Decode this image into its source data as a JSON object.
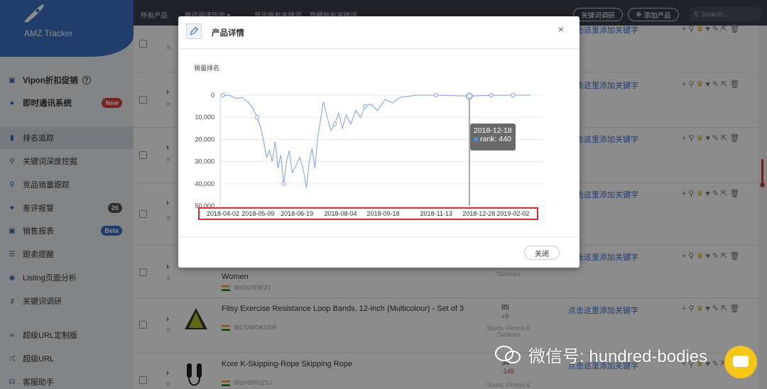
{
  "sidebar": {
    "brand": "AMZ Tracker",
    "items": [
      {
        "label": "Vipon折扣促销",
        "icon": "gift-icon",
        "help": "?"
      },
      {
        "label": "即时通讯系统",
        "icon": "chat-icon",
        "badge": "New"
      },
      {
        "label": "排名追踪",
        "icon": "bar-chart-icon"
      },
      {
        "label": "关键词深度挖掘",
        "icon": "search-icon"
      },
      {
        "label": "竞品销量跟踪",
        "icon": "search-icon"
      },
      {
        "label": "差评报警",
        "icon": "heart-icon",
        "badge": "26"
      },
      {
        "label": "销售报表",
        "icon": "gift-icon",
        "badge": "Beta"
      },
      {
        "label": "跟卖提醒",
        "icon": "list-icon"
      },
      {
        "label": "Listing页面分析",
        "icon": "eye-icon"
      },
      {
        "label": "关键词调研",
        "icon": "key-icon"
      },
      {
        "label": "超级URL定制版",
        "icon": "link-icon"
      },
      {
        "label": "超级URL",
        "icon": "shuffle-icon"
      },
      {
        "label": "客服助手",
        "icon": "headset-icon"
      }
    ]
  },
  "topbar": {
    "all_products": "所有产品",
    "history": "最近阅读历史 ▾",
    "show_all": "显示所有关键词",
    "hide_all": "隐藏所有关键词",
    "keyword_research_btn": "关键词调研",
    "add_product_btn": "添加产品",
    "search_placeholder": "Search..."
  },
  "table": {
    "add_keyword_link": "点击这里添加关键字",
    "rows": [
      {
        "title": "Women",
        "asin": "B01N7E3E21",
        "category": "Outdoors"
      },
      {
        "title": "Fitsy Exercise Resistance Loop Bands, 12-inch (Multicolour) - Set of 3",
        "asin": "B07DWDKGDR",
        "rank": "85",
        "delta": "+9",
        "category": "Sports, Fitness & Outdoors"
      },
      {
        "title": "Kore K-Skipping-Rope Skipping Rope",
        "asin": "B01N9PUZSJ",
        "rank": "34",
        "delta": "-145",
        "category": "Sports, Fitness &"
      }
    ]
  },
  "modal": {
    "title": "产品详情",
    "close_icon": "×",
    "close_button": "关闭"
  },
  "chart_data": {
    "type": "line",
    "title": "",
    "ylabel": "销量排名",
    "xlabel": "",
    "y_inverted": true,
    "ylim": [
      0,
      50000
    ],
    "y_ticks": [
      "0",
      "10,000",
      "20,000",
      "30,000",
      "40,000",
      "50,000"
    ],
    "x_ticks": [
      "2018-04-02",
      "2018-05-09",
      "2018-06-19",
      "2018-08-04",
      "2018-09-18",
      "2018-11-13",
      "2018-12-28",
      "2019-02-02"
    ],
    "grid": true,
    "line_color": "#7b9ee6",
    "series": [
      {
        "values": [
          {
            "x": "2018-04-02",
            "y": 0
          },
          {
            "x": "2018-04-09",
            "y": 200
          },
          {
            "x": "2018-04-16",
            "y": 1500
          },
          {
            "x": "2018-04-22",
            "y": 1000
          },
          {
            "x": "2018-04-28",
            "y": 3000
          },
          {
            "x": "2018-05-03",
            "y": 5500
          },
          {
            "x": "2018-05-08",
            "y": 10000
          },
          {
            "x": "2018-05-12",
            "y": 15000
          },
          {
            "x": "2018-05-15",
            "y": 21000
          },
          {
            "x": "2018-05-18",
            "y": 28000
          },
          {
            "x": "2018-05-21",
            "y": 25000
          },
          {
            "x": "2018-05-24",
            "y": 30000
          },
          {
            "x": "2018-05-27",
            "y": 21000
          },
          {
            "x": "2018-05-30",
            "y": 33000
          },
          {
            "x": "2018-06-02",
            "y": 27000
          },
          {
            "x": "2018-06-05",
            "y": 40000
          },
          {
            "x": "2018-06-08",
            "y": 30000
          },
          {
            "x": "2018-06-11",
            "y": 25000
          },
          {
            "x": "2018-06-14",
            "y": 35000
          },
          {
            "x": "2018-06-18",
            "y": 32000
          },
          {
            "x": "2018-06-22",
            "y": 28000
          },
          {
            "x": "2018-06-26",
            "y": 34000
          },
          {
            "x": "2018-06-29",
            "y": 42000
          },
          {
            "x": "2018-07-02",
            "y": 30000
          },
          {
            "x": "2018-07-05",
            "y": 24000
          },
          {
            "x": "2018-07-08",
            "y": 33000
          },
          {
            "x": "2018-07-11",
            "y": 19000
          },
          {
            "x": "2018-07-14",
            "y": 11000
          },
          {
            "x": "2018-07-17",
            "y": 3000
          },
          {
            "x": "2018-07-21",
            "y": 10000
          },
          {
            "x": "2018-07-25",
            "y": 16000
          },
          {
            "x": "2018-07-29",
            "y": 13000
          },
          {
            "x": "2018-08-02",
            "y": 8000
          },
          {
            "x": "2018-08-06",
            "y": 15000
          },
          {
            "x": "2018-08-10",
            "y": 9000
          },
          {
            "x": "2018-08-15",
            "y": 13000
          },
          {
            "x": "2018-08-20",
            "y": 7000
          },
          {
            "x": "2018-08-25",
            "y": 10000
          },
          {
            "x": "2018-08-30",
            "y": 5000
          },
          {
            "x": "2018-09-05",
            "y": 4000
          },
          {
            "x": "2018-09-12",
            "y": 7000
          },
          {
            "x": "2018-09-20",
            "y": 2000
          },
          {
            "x": "2018-09-28",
            "y": 3500
          },
          {
            "x": "2018-10-06",
            "y": 1000
          },
          {
            "x": "2018-10-15",
            "y": 500
          },
          {
            "x": "2018-10-25",
            "y": 0
          },
          {
            "x": "2018-11-13",
            "y": 0
          },
          {
            "x": "2018-12-18",
            "y": 440
          },
          {
            "x": "2019-01-10",
            "y": 100
          },
          {
            "x": "2019-02-02",
            "y": 0
          },
          {
            "x": "2019-02-20",
            "y": 0
          }
        ]
      }
    ],
    "tooltip": {
      "date": "2018-12-18",
      "label": "rank: 440"
    }
  },
  "watermark": {
    "text": "微信号: hundred-bodies"
  }
}
